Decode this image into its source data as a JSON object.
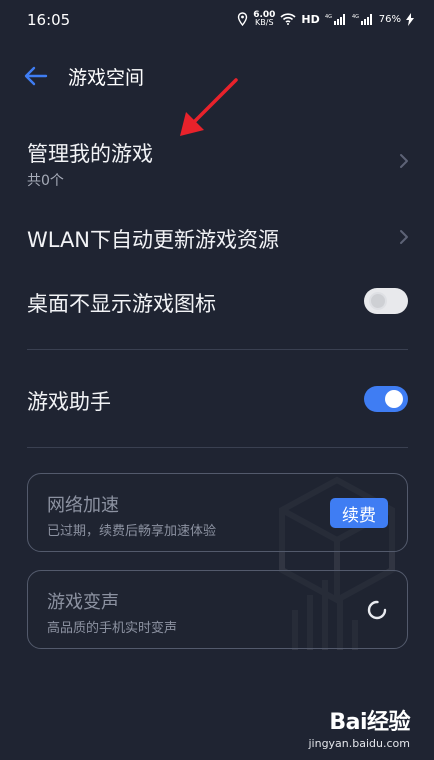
{
  "status_bar": {
    "time": "16:05",
    "net_speed_value": "6.00",
    "net_speed_unit": "KB/S",
    "hd_label": "HD",
    "signal1_label": "4G",
    "signal2_label": "4G",
    "battery": "76%"
  },
  "header": {
    "title": "游戏空间"
  },
  "rows": {
    "manage_games": {
      "title": "管理我的游戏",
      "subtitle": "共0个"
    },
    "wlan_update": {
      "title": "WLAN下自动更新游戏资源"
    },
    "hide_icon": {
      "title": "桌面不显示游戏图标",
      "toggle_on": false
    },
    "game_assistant": {
      "title": "游戏助手",
      "toggle_on": true
    }
  },
  "cards": {
    "network_boost": {
      "title": "网络加速",
      "subtitle": "已过期，续费后畅享加速体验",
      "button_label": "续费"
    },
    "voice_changer": {
      "title": "游戏变声",
      "subtitle": "高品质的手机实时变声"
    }
  },
  "watermark": {
    "logo": "Bai经验",
    "url": "jingyan.baidu.com"
  },
  "colors": {
    "background": "#1f2432",
    "accent": "#3f7df3",
    "annotation_arrow": "#e8222b"
  }
}
